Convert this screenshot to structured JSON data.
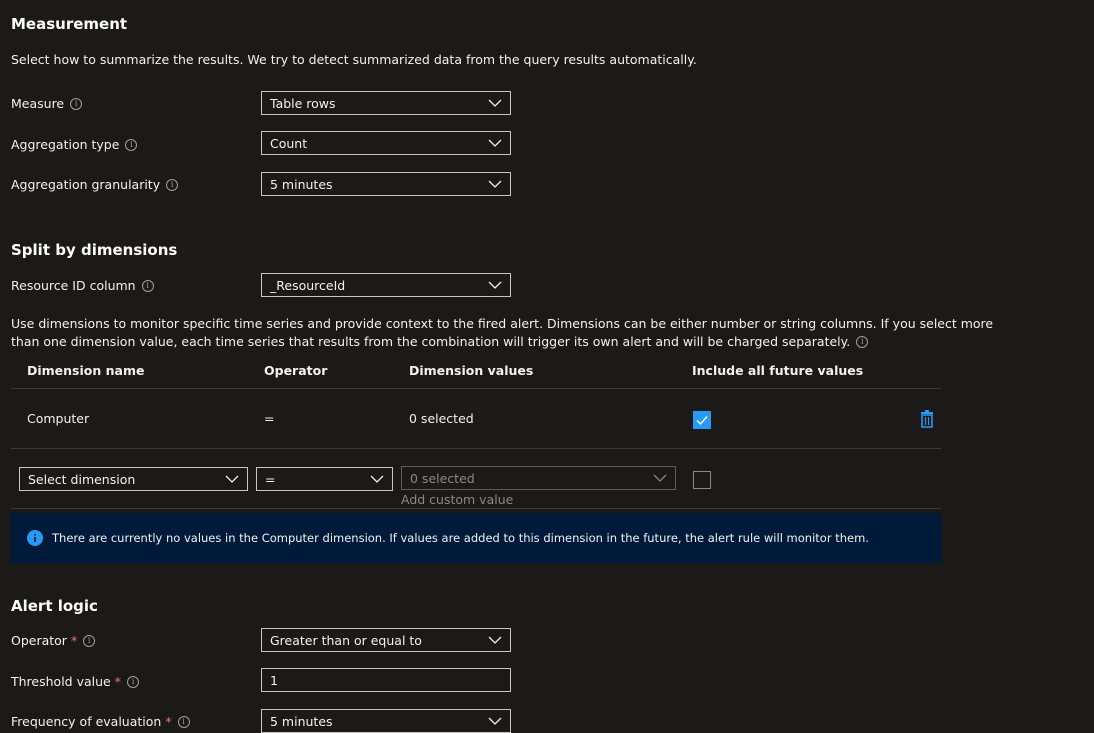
{
  "measurement": {
    "title": "Measurement",
    "description": "Select how to summarize the results. We try to detect summarized data from the query results automatically.",
    "measure": {
      "label": "Measure",
      "value": "Table rows"
    },
    "aggregation_type": {
      "label": "Aggregation type",
      "value": "Count"
    },
    "aggregation_granularity": {
      "label": "Aggregation granularity",
      "value": "5 minutes"
    }
  },
  "split": {
    "title": "Split by dimensions",
    "resource_id": {
      "label": "Resource ID column",
      "value": "_ResourceId"
    },
    "description_line1": "Use dimensions to monitor specific time series and provide context to the fired alert. Dimensions can be either number or string columns. If you select more",
    "description_line2": "than one dimension value, each time series that results from the combination will trigger its own alert and will be charged separately.",
    "columns": [
      "Dimension name",
      "Operator",
      "Dimension values",
      "Include all future values"
    ],
    "rows": [
      {
        "name": "Computer",
        "operator": "=",
        "values": "0 selected",
        "include_future": true
      }
    ],
    "new_row": {
      "dimension_placeholder": "Select dimension",
      "operator": "=",
      "values_placeholder": "0 selected",
      "add_custom": "Add custom value"
    },
    "info_banner": "There are currently no values in the Computer dimension. If values are added to this dimension in the future, the alert rule will monitor them."
  },
  "alert_logic": {
    "title": "Alert logic",
    "operator": {
      "label": "Operator",
      "value": "Greater than or equal to"
    },
    "threshold": {
      "label": "Threshold value",
      "value": "1"
    },
    "frequency": {
      "label": "Frequency of evaluation",
      "value": "5 minutes"
    }
  },
  "colors": {
    "accent": "#2899f5",
    "background": "#1b1a19",
    "banner": "#001a3b",
    "required": "#f1707b"
  }
}
